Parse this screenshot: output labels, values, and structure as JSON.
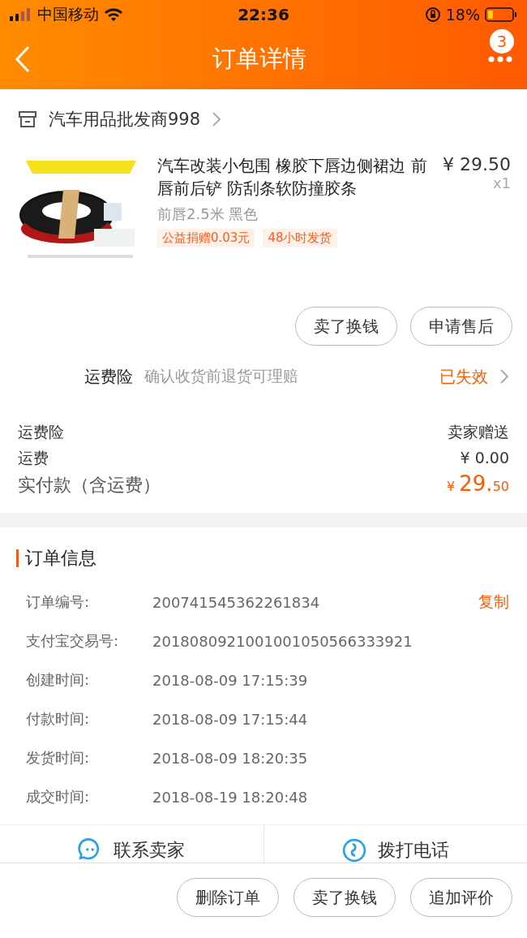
{
  "status_bar": {
    "carrier": "中国移动",
    "time": "22:36",
    "battery": "18%"
  },
  "nav": {
    "title": "订单详情",
    "badge": "3"
  },
  "shop": {
    "name": "汽车用品批发商998"
  },
  "product": {
    "image": {
      "kind": "picture"
    },
    "title": "汽车改装小包围 橡胶下唇边侧裙边 前唇前后铲 防刮条软防撞胶条",
    "price": "¥ 29.50",
    "quantity": "x1",
    "variant": "前唇2.5米 黑色",
    "tags": [
      "公益捐赠0.03元",
      "48小时发货"
    ]
  },
  "item_actions": [
    "卖了换钱",
    "申请售后"
  ],
  "insurance": {
    "label": "运费险",
    "description": "确认收货前退货可理赔",
    "status": "已失效"
  },
  "fees": [
    {
      "kind": "plain",
      "label": "运费险",
      "value": "卖家赠送"
    },
    {
      "kind": "plain",
      "label": "运费",
      "value": "¥ 0.00"
    },
    {
      "kind": "total",
      "label": "实付款（含运费）",
      "currency": "¥",
      "amount": "29.",
      "fraction": "50"
    }
  ],
  "order_info": {
    "title": "订单信息",
    "rows": [
      {
        "label": "订单编号:",
        "value": "200741545362261834",
        "action": "复制"
      },
      {
        "label": "支付宝交易号:",
        "value": "2018080921001001050566333921"
      },
      {
        "label": "创建时间:",
        "value": "2018-08-09 17:15:39"
      },
      {
        "label": "付款时间:",
        "value": "2018-08-09 17:15:44"
      },
      {
        "label": "发货时间:",
        "value": "2018-08-09 18:20:35"
      },
      {
        "label": "成交时间:",
        "value": "2018-08-19 18:20:48"
      }
    ]
  },
  "contact": [
    {
      "kind": "chat",
      "label": "联系卖家"
    },
    {
      "kind": "phone",
      "label": "拨打电话"
    }
  ],
  "bottom_actions": [
    "删除订单",
    "卖了换钱",
    "追加评价"
  ]
}
